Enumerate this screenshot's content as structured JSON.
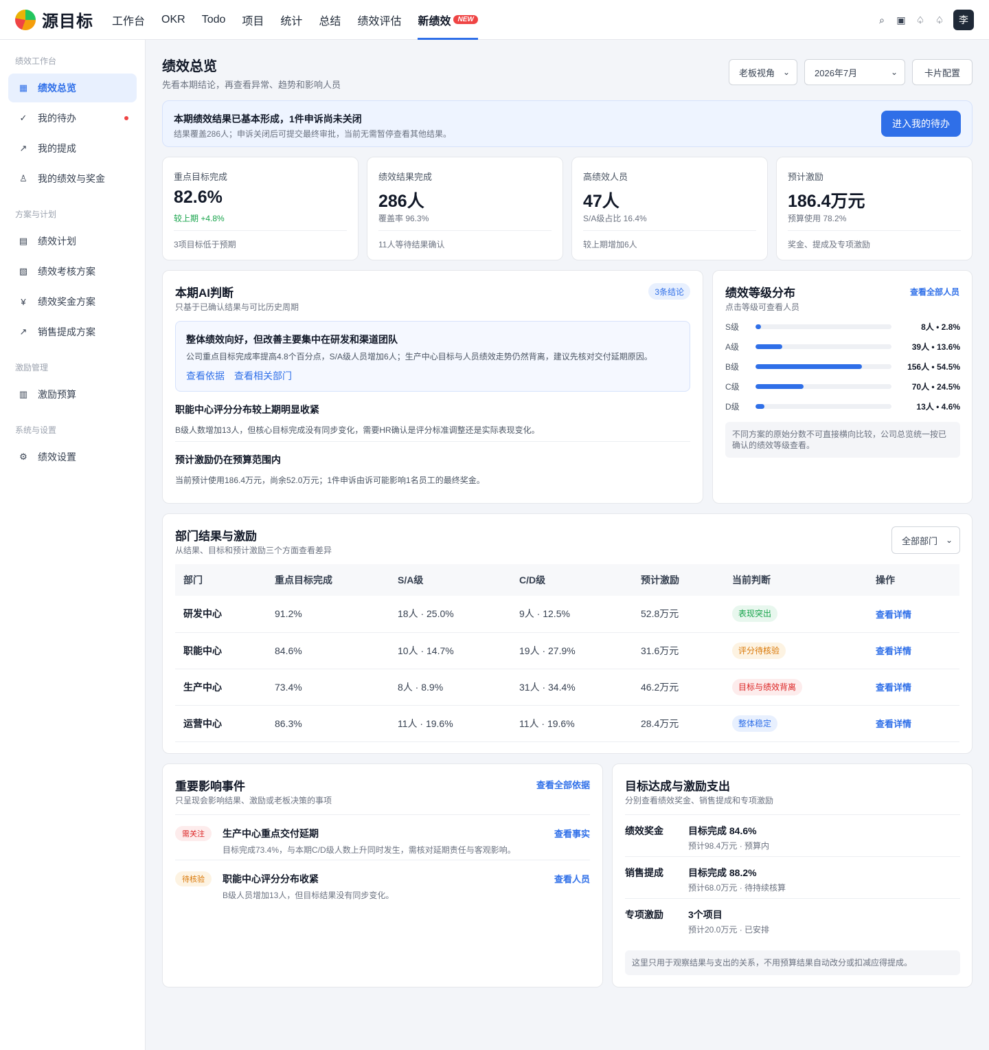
{
  "app": {
    "name": "源目标"
  },
  "nav": [
    {
      "label": "工作台"
    },
    {
      "label": "OKR"
    },
    {
      "label": "Todo"
    },
    {
      "label": "项目"
    },
    {
      "label": "统计"
    },
    {
      "label": "总结"
    },
    {
      "label": "绩效评估"
    },
    {
      "label": "新绩效",
      "badge": "NEW"
    }
  ],
  "user": {
    "avatar": "李"
  },
  "top_icons": [
    "search-icon",
    "window-icon",
    "bell-icon",
    "notification-icon"
  ],
  "sidebar": {
    "groups": [
      {
        "label": "绩效工作台",
        "items": [
          {
            "label": "绩效总览",
            "icon": "grid-icon",
            "glyph": "▦",
            "active": true
          },
          {
            "label": "我的待办",
            "icon": "check-icon",
            "glyph": "✓",
            "dot": true
          },
          {
            "label": "我的提成",
            "icon": "trend-icon",
            "glyph": "↗"
          },
          {
            "label": "我的绩效与奖金",
            "icon": "medal-icon",
            "glyph": "♙"
          }
        ]
      },
      {
        "label": "方案与计划",
        "items": [
          {
            "label": "绩效计划",
            "icon": "list-icon",
            "glyph": "▤"
          },
          {
            "label": "绩效考核方案",
            "icon": "checklist-icon",
            "glyph": "▧"
          },
          {
            "label": "绩效奖金方案",
            "icon": "yen-icon",
            "glyph": "¥"
          },
          {
            "label": "销售提成方案",
            "icon": "trend-icon",
            "glyph": "↗"
          }
        ]
      },
      {
        "label": "激励管理",
        "items": [
          {
            "label": "激励预算",
            "icon": "budget-icon",
            "glyph": "▥"
          }
        ]
      },
      {
        "label": "系统与设置",
        "items": [
          {
            "label": "绩效设置",
            "icon": "gear-icon",
            "glyph": "⚙"
          }
        ]
      }
    ]
  },
  "page": {
    "title": "绩效总览",
    "subtitle": "先看本期结论，再查看异常、趋势和影响人员",
    "view_select": "老板视角",
    "period_select": "2026年7月",
    "config_button": "卡片配置"
  },
  "banner": {
    "title": "本期绩效结果已基本形成，1件申诉尚未关闭",
    "desc": "结果覆盖286人；申诉关闭后可提交最终审批，当前无需暂停查看其他结果。",
    "button": "进入我的待办"
  },
  "kpis": [
    {
      "label": "重点目标完成",
      "value": "82.6%",
      "sub": "较上期 +4.8%",
      "sub_positive": true,
      "foot": "3项目标低于预期"
    },
    {
      "label": "绩效结果完成",
      "value": "286人",
      "sub": "覆盖率 96.3%",
      "foot": "11人等待结果确认"
    },
    {
      "label": "高绩效人员",
      "value": "47人",
      "sub": "S/A级占比 16.4%",
      "foot": "较上期增加6人"
    },
    {
      "label": "预计激励",
      "value": "186.4万元",
      "sub": "预算使用 78.2%",
      "foot": "奖金、提成及专项激励"
    }
  ],
  "ai": {
    "title": "本期AI判断",
    "subtitle": "只基于已确认结果与可比历史周期",
    "badge": "3条结论",
    "highlight": {
      "title": "整体绩效向好，但改善主要集中在研发和渠道团队",
      "desc": "公司重点目标完成率提高4.8个百分点，S/A级人员增加6人；生产中心目标与人员绩效走势仍然背离，建议先核对交付延期原因。",
      "link1": "查看依据",
      "link2": "查看相关部门"
    },
    "items": [
      {
        "title": "职能中心评分分布较上期明显收紧",
        "desc": "B级人数增加13人，但核心目标完成没有同步变化，需要HR确认是评分标准调整还是实际表现变化。"
      },
      {
        "title": "预计激励仍在预算范围内",
        "desc": "当前预计使用186.4万元，尚余52.0万元；1件申诉由诉可能影响1名员工的最终奖金。"
      }
    ]
  },
  "grades": {
    "title": "绩效等级分布",
    "subtitle": "点击等级可查看人员",
    "link": "查看全部人员",
    "rows": [
      {
        "label": "S级",
        "value": "8人 • 2.8%",
        "share": 0.028
      },
      {
        "label": "A级",
        "value": "39人 • 13.6%",
        "share": 0.136
      },
      {
        "label": "B级",
        "value": "156人 • 54.5%",
        "share": 0.545
      },
      {
        "label": "C级",
        "value": "70人 • 24.5%",
        "share": 0.245
      },
      {
        "label": "D级",
        "value": "13人 • 4.6%",
        "share": 0.046
      }
    ],
    "note": "不同方案的原始分数不可直接横向比较，公司总览统一按已确认的绩效等级查看。"
  },
  "dept": {
    "title": "部门结果与激励",
    "subtitle": "从结果、目标和预计激励三个方面查看差异",
    "filter": "全部部门",
    "columns": [
      "部门",
      "重点目标完成",
      "S/A级",
      "C/D级",
      "预计激励",
      "当前判断",
      "操作"
    ],
    "rows": [
      {
        "name": "研发中心",
        "goal": "91.2%",
        "sa": "18人 · 25.0%",
        "cd": "9人 · 12.5%",
        "incentive": "52.8万元",
        "status": "表现突出",
        "tone": "green",
        "action": "查看详情"
      },
      {
        "name": "职能中心",
        "goal": "84.6%",
        "sa": "10人 · 14.7%",
        "cd": "19人 · 27.9%",
        "incentive": "31.6万元",
        "status": "评分待核验",
        "tone": "orange",
        "action": "查看详情"
      },
      {
        "name": "生产中心",
        "goal": "73.4%",
        "sa": "8人 · 8.9%",
        "cd": "31人 · 34.4%",
        "incentive": "46.2万元",
        "status": "目标与绩效背离",
        "tone": "red",
        "action": "查看详情"
      },
      {
        "name": "运营中心",
        "goal": "86.3%",
        "sa": "11人 · 19.6%",
        "cd": "11人 · 19.6%",
        "incentive": "28.4万元",
        "status": "整体稳定",
        "tone": "blue",
        "action": "查看详情"
      }
    ]
  },
  "events": {
    "title": "重要影响事件",
    "subtitle": "只呈现会影响结果、激励或老板决策的事项",
    "link": "查看全部依据",
    "items": [
      {
        "tag": "需关注",
        "tone": "red",
        "title": "生产中心重点交付延期",
        "desc": "目标完成73.4%，与本期C/D级人数上升同时发生，需核对延期责任与客观影响。",
        "action": "查看事实"
      },
      {
        "tag": "待核验",
        "tone": "orange",
        "title": "职能中心评分分布收紧",
        "desc": "B级人员增加13人，但目标结果没有同步变化。",
        "action": "查看人员"
      }
    ]
  },
  "incentive": {
    "title": "目标达成与激励支出",
    "subtitle": "分别查看绩效奖金、销售提成和专项激励",
    "rows": [
      {
        "label": "绩效奖金",
        "value": "目标完成 84.6%",
        "desc": "预计98.4万元 · 预算内"
      },
      {
        "label": "销售提成",
        "value": "目标完成 88.2%",
        "desc": "预计68.0万元 · 待持续核算"
      },
      {
        "label": "专项激励",
        "value": "3个项目",
        "desc": "预计20.0万元 · 已安排"
      }
    ],
    "note": "这里只用于观察结果与支出的关系，不用预算结果自动改分或扣减应得提成。"
  },
  "colors": {
    "accent": "#2f6fe8",
    "positive": "#16a34a",
    "danger": "#ef4444",
    "warning": "#d97706"
  }
}
